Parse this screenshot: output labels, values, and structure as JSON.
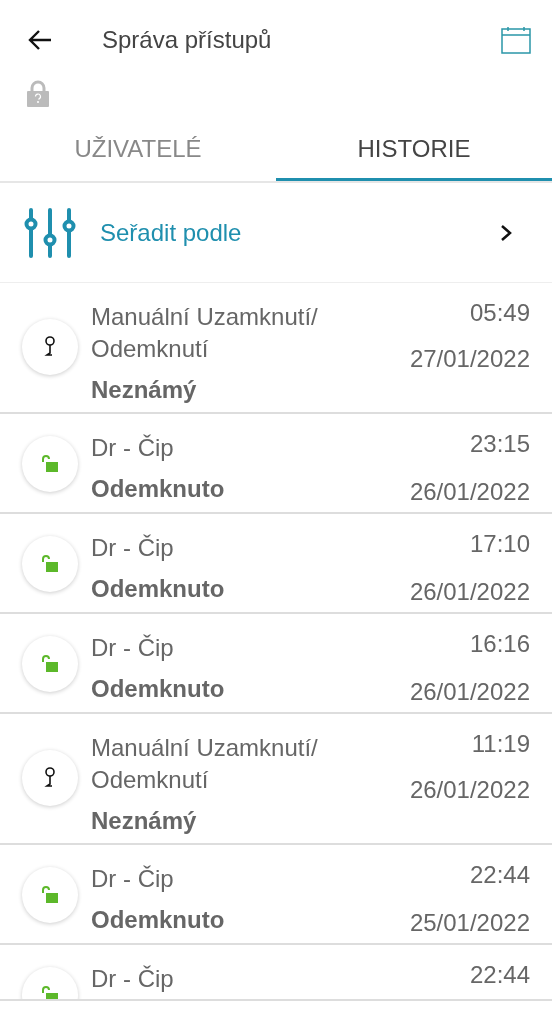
{
  "header": {
    "title": "Správa přístupů"
  },
  "tabs": [
    {
      "label": "UŽIVATELÉ",
      "selected": false
    },
    {
      "label": "HISTORIE",
      "selected": true
    }
  ],
  "sort": {
    "label": "Seřadit podle"
  },
  "events": [
    {
      "kind": "manual",
      "title": "Manuální Uzamknutí/ Odemknutí",
      "status": "Neznámý",
      "time": "05:49",
      "date": "27/01/2022"
    },
    {
      "kind": "unlocked",
      "title": "Dr - Čip",
      "status": "Odemknuto",
      "time": "23:15",
      "date": "26/01/2022"
    },
    {
      "kind": "unlocked",
      "title": "Dr - Čip",
      "status": "Odemknuto",
      "time": "17:10",
      "date": "26/01/2022"
    },
    {
      "kind": "unlocked",
      "title": "Dr - Čip",
      "status": "Odemknuto",
      "time": "16:16",
      "date": "26/01/2022"
    },
    {
      "kind": "manual",
      "title": "Manuální Uzamknutí/ Odemknutí",
      "status": "Neznámý",
      "time": "11:19",
      "date": "26/01/2022"
    },
    {
      "kind": "unlocked",
      "title": "Dr - Čip",
      "status": "Odemknuto",
      "time": "22:44",
      "date": "25/01/2022"
    },
    {
      "kind": "unlocked",
      "title": "Dr - Čip",
      "time": "22:44",
      "partial": true
    }
  ]
}
